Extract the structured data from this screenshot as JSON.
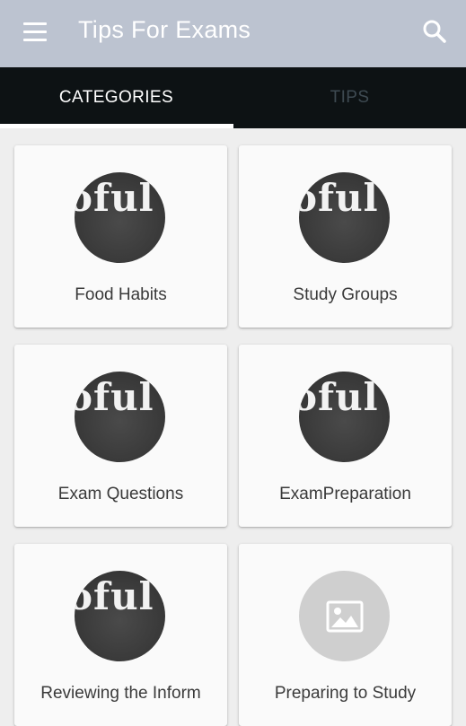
{
  "appbar": {
    "title": "Tips For Exams",
    "menu_icon": "hamburger-menu-icon",
    "search_icon": "search-icon",
    "background": "#bcc3d0"
  },
  "tabs": [
    {
      "label": "CATEGORIES",
      "active": true
    },
    {
      "label": "TIPS",
      "active": false
    }
  ],
  "categories": [
    {
      "label": "Food Habits",
      "image": "chalkboard-thumbnail",
      "chalk_text": "oful T"
    },
    {
      "label": "Study Groups",
      "image": "chalkboard-thumbnail",
      "chalk_text": "oful T"
    },
    {
      "label": "Exam Questions",
      "image": "chalkboard-thumbnail",
      "chalk_text": "oful T"
    },
    {
      "label": "ExamPreparation",
      "image": "chalkboard-thumbnail",
      "chalk_text": "oful T"
    },
    {
      "label": "Reviewing the Inform",
      "image": "chalkboard-thumbnail",
      "chalk_text": "oful T"
    },
    {
      "label": "Preparing to Study",
      "image": "image-placeholder-icon"
    }
  ]
}
